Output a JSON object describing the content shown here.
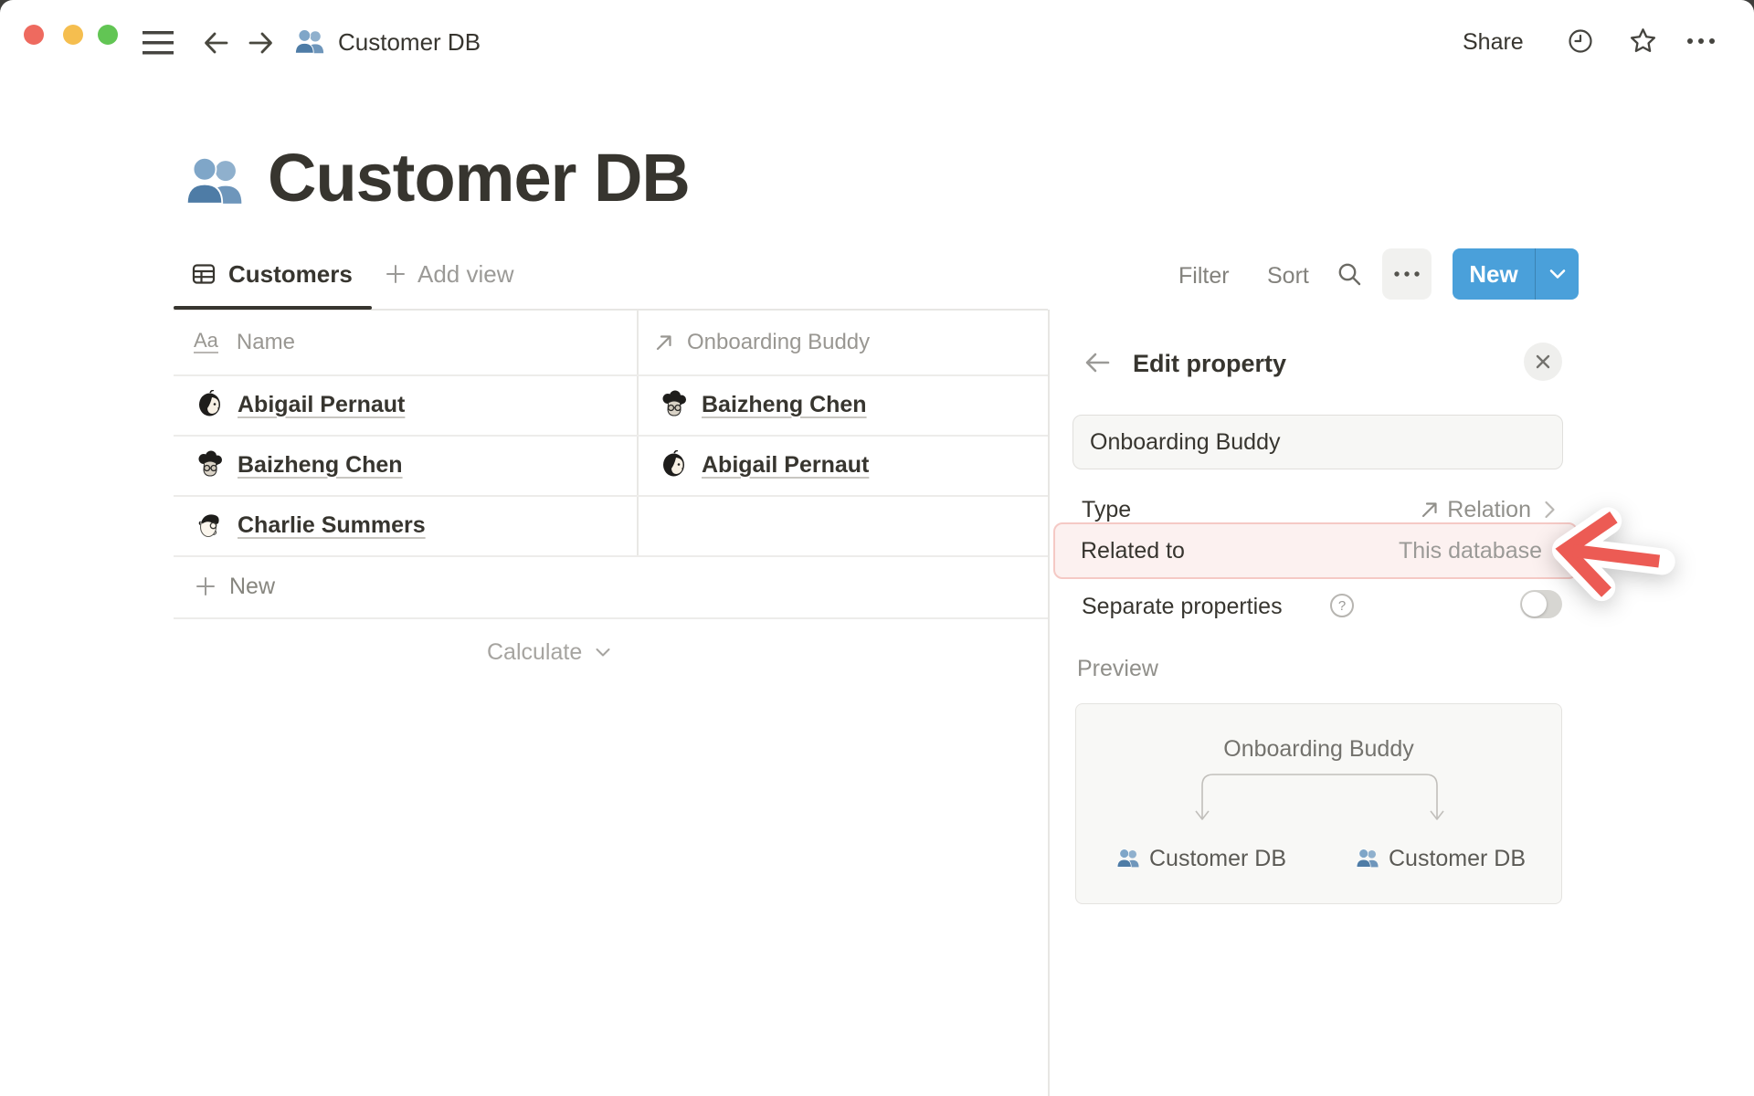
{
  "colors": {
    "accent_blue": "#4AA0DA",
    "highlight_bg": "#FCF1F0",
    "highlight_border": "#F5C9C5",
    "arrow_red": "#EC5B54",
    "toggle_off": "#D7D6D2"
  },
  "topbar": {
    "breadcrumb": "Customer DB",
    "share": "Share"
  },
  "page": {
    "title": "Customer DB"
  },
  "views": {
    "tab": "Customers",
    "add_view": "Add view"
  },
  "toolbar": {
    "filter": "Filter",
    "sort": "Sort",
    "new": "New"
  },
  "table": {
    "headers": [
      {
        "icon_glyph": "Aa",
        "label": "Name"
      },
      {
        "label": "Onboarding Buddy"
      }
    ],
    "rows": [
      {
        "name": "Abigail Pernaut",
        "buddy": "Baizheng Chen"
      },
      {
        "name": "Baizheng Chen",
        "buddy": "Abigail Pernaut"
      },
      {
        "name": "Charlie Summers",
        "buddy": ""
      }
    ],
    "new_row": "New",
    "calculate": "Calculate"
  },
  "panel": {
    "title": "Edit property",
    "name_value": "Onboarding Buddy",
    "type_label": "Type",
    "type_value": "Relation",
    "related_label": "Related to",
    "related_value": "This database",
    "separate_label": "Separate properties",
    "help_glyph": "?",
    "preview_label": "Preview",
    "preview": {
      "property": "Onboarding Buddy",
      "left_db": "Customer DB",
      "right_db": "Customer DB"
    }
  }
}
